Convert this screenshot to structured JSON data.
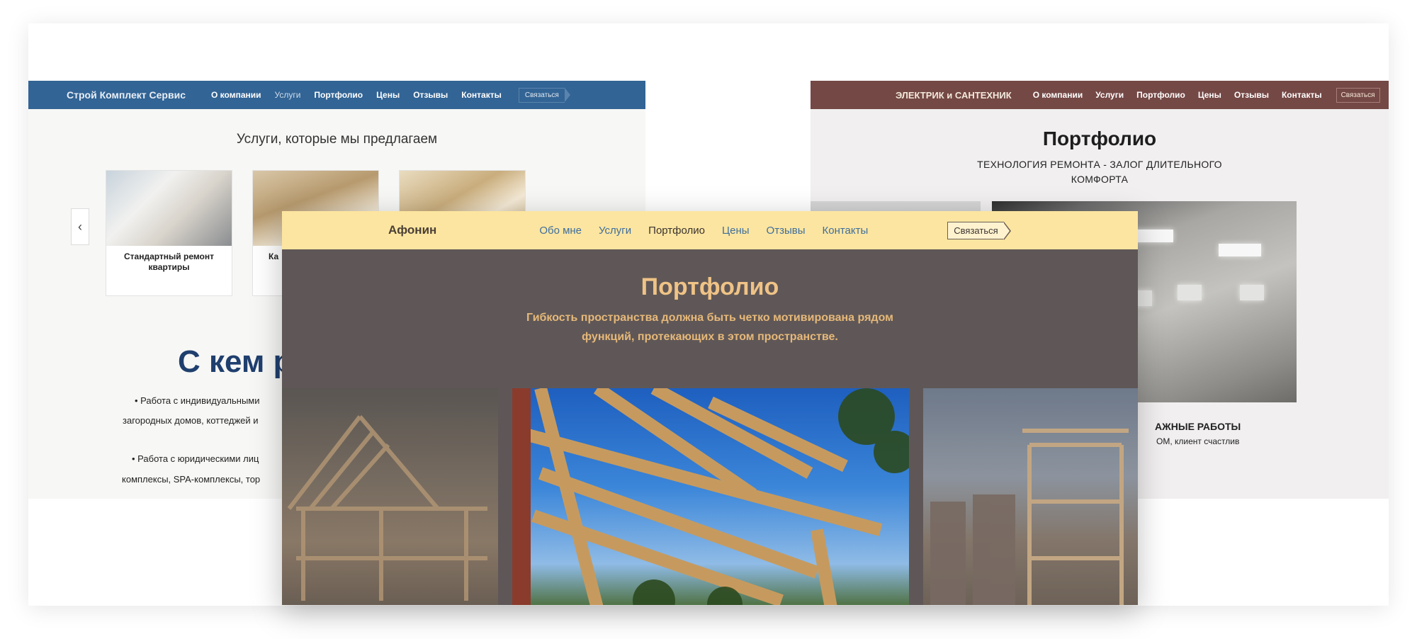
{
  "left_site": {
    "brand": "Строй Комплект Сервис",
    "menu": [
      "О компании",
      "Услуги",
      "Портфолио",
      "Цены",
      "Отзывы",
      "Контакты"
    ],
    "active_menu": "Услуги",
    "cta": "Связаться",
    "section_title": "Услуги, которые мы предлагаем",
    "cards": [
      {
        "label": "Стандартный ремонт квартиры"
      },
      {
        "label": "Ка"
      },
      {
        "label": ""
      }
    ],
    "big_heading": "С кем р",
    "bullets": [
      "• Работа с индивидуальными",
      "загородных домов, коттеджей и",
      "• Работа с юридическими лиц",
      "комплексы, SPA-комплексы, тор"
    ]
  },
  "right_site": {
    "brand": "ЭЛЕКТРИК и САНТЕХНИК",
    "menu": [
      "О компании",
      "Услуги",
      "Портфолио",
      "Цены",
      "Отзывы",
      "Контакты"
    ],
    "cta": "Связаться",
    "title": "Портфолио",
    "subtitle_line1": "ТЕХНОЛОГИЯ РЕМОНТА - ЗАЛОГ ДЛИТЕЛЬНОГО",
    "subtitle_line2": "КОМФОРТА",
    "caption": "АЖНЫЕ РАБОТЫ",
    "caption_sub": "ОМ, клиент счастлив"
  },
  "center_site": {
    "brand": "Афонин",
    "menu": [
      "Обо мне",
      "Услуги",
      "Портфолио",
      "Цены",
      "Отзывы",
      "Контакты"
    ],
    "active_menu": "Портфолио",
    "cta": "Связаться",
    "title": "Портфолио",
    "subtitle": "Гибкость пространства должна быть четко мотивирована рядом функций, протекающих в этом пространстве."
  },
  "colors": {
    "left_nav": "#326495",
    "right_nav": "#744845",
    "center_nav": "#fce5a0",
    "center_bg": "#5f5757",
    "center_accent": "#efc386"
  }
}
